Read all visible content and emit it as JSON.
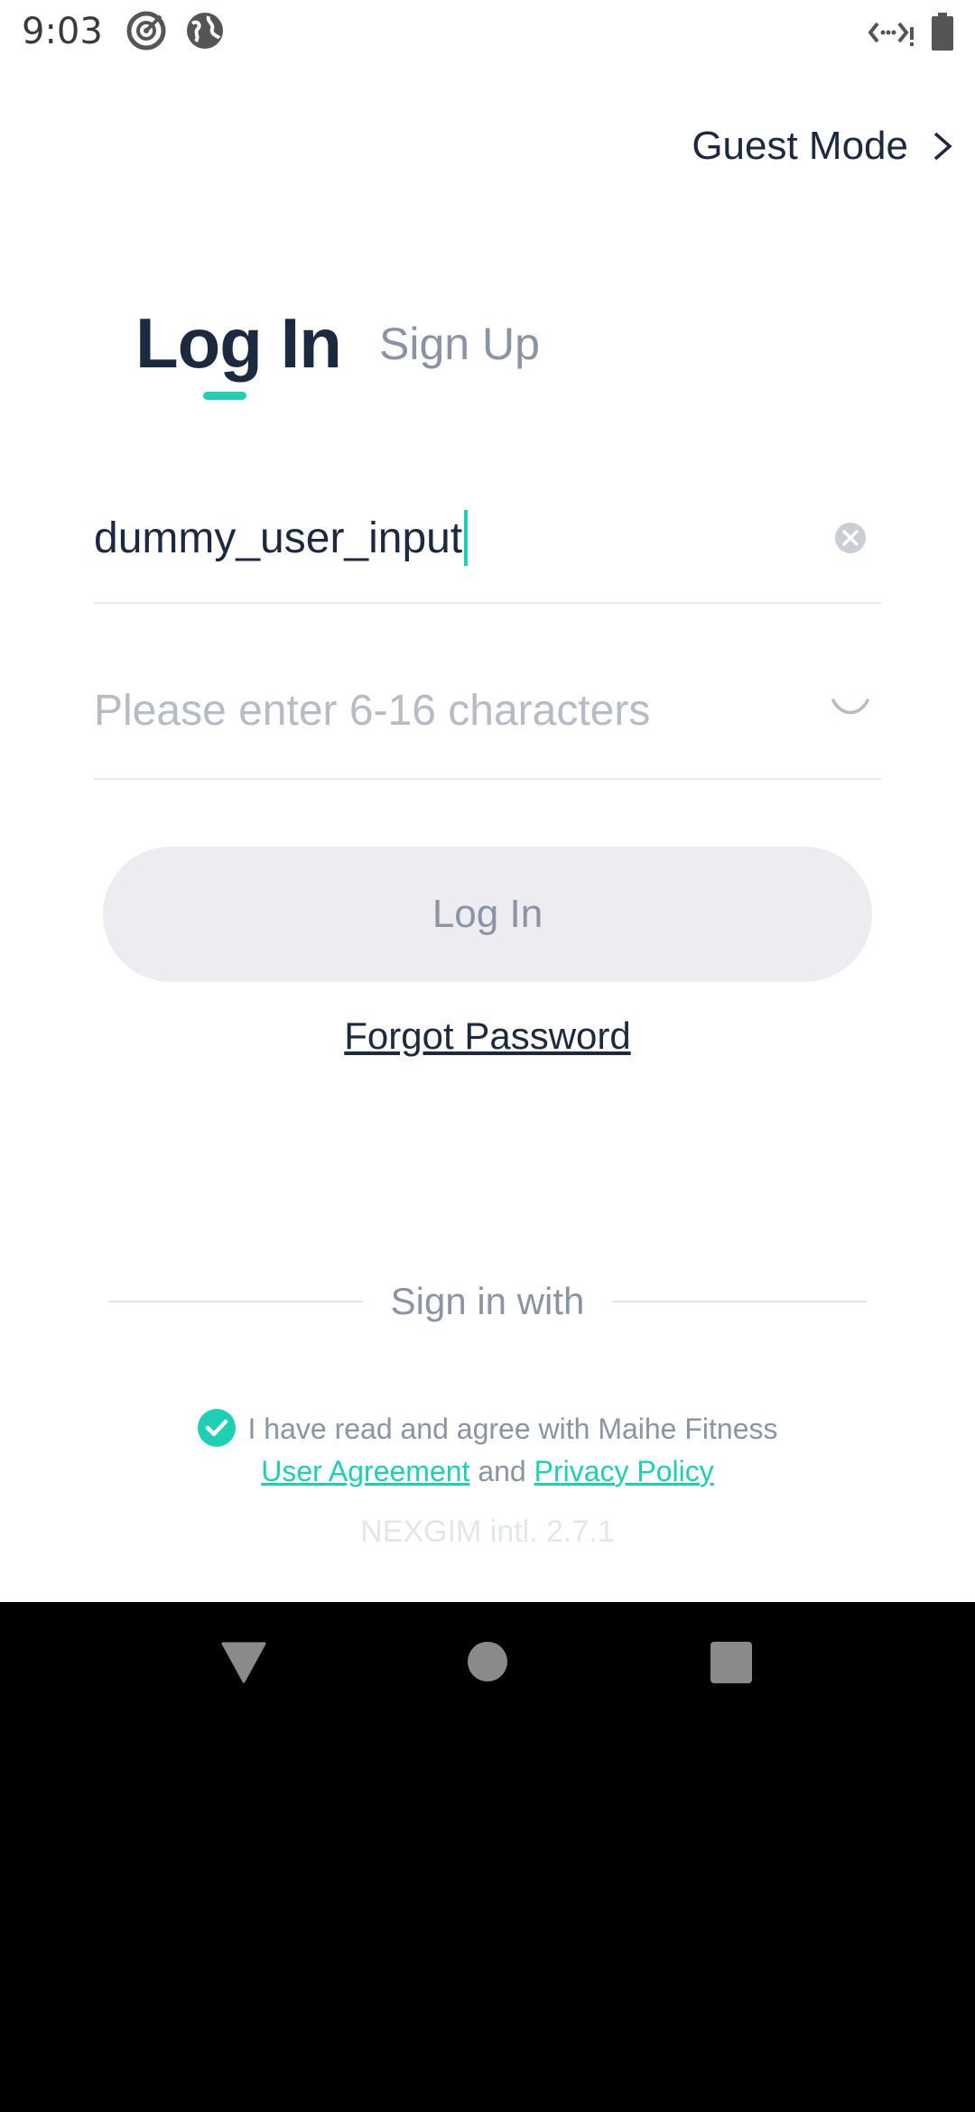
{
  "status_bar": {
    "time": "9:03"
  },
  "guest_mode": {
    "label": "Guest Mode"
  },
  "tabs": [
    {
      "label": "Log In",
      "active": true
    },
    {
      "label": "Sign Up",
      "active": false
    }
  ],
  "username_field": {
    "value": "dummy_user_input"
  },
  "password_field": {
    "placeholder": "Please enter 6-16 characters"
  },
  "login_button": {
    "label": "Log In"
  },
  "forgot_password": {
    "label": "Forgot Password"
  },
  "sign_in_with": {
    "label": "Sign in with"
  },
  "agreement": {
    "text": "I have read and agree with Maihe Fitness",
    "user_agreement": "User Agreement",
    "and": "and",
    "privacy_policy": "Privacy Policy",
    "checked": true
  },
  "version": {
    "text": "NEXGIM intl. 2.7.1"
  },
  "colors": {
    "accent": "#1ecfb4",
    "primary_text": "#1c2a3f",
    "muted_text": "#8b94a3"
  },
  "icons": [
    "target-icon",
    "globe-icon",
    "data-saver-icon",
    "battery-icon",
    "chevron-right-icon",
    "clear-icon",
    "eye-closed-icon",
    "check-circle-icon",
    "back-icon",
    "home-icon",
    "recents-icon"
  ]
}
